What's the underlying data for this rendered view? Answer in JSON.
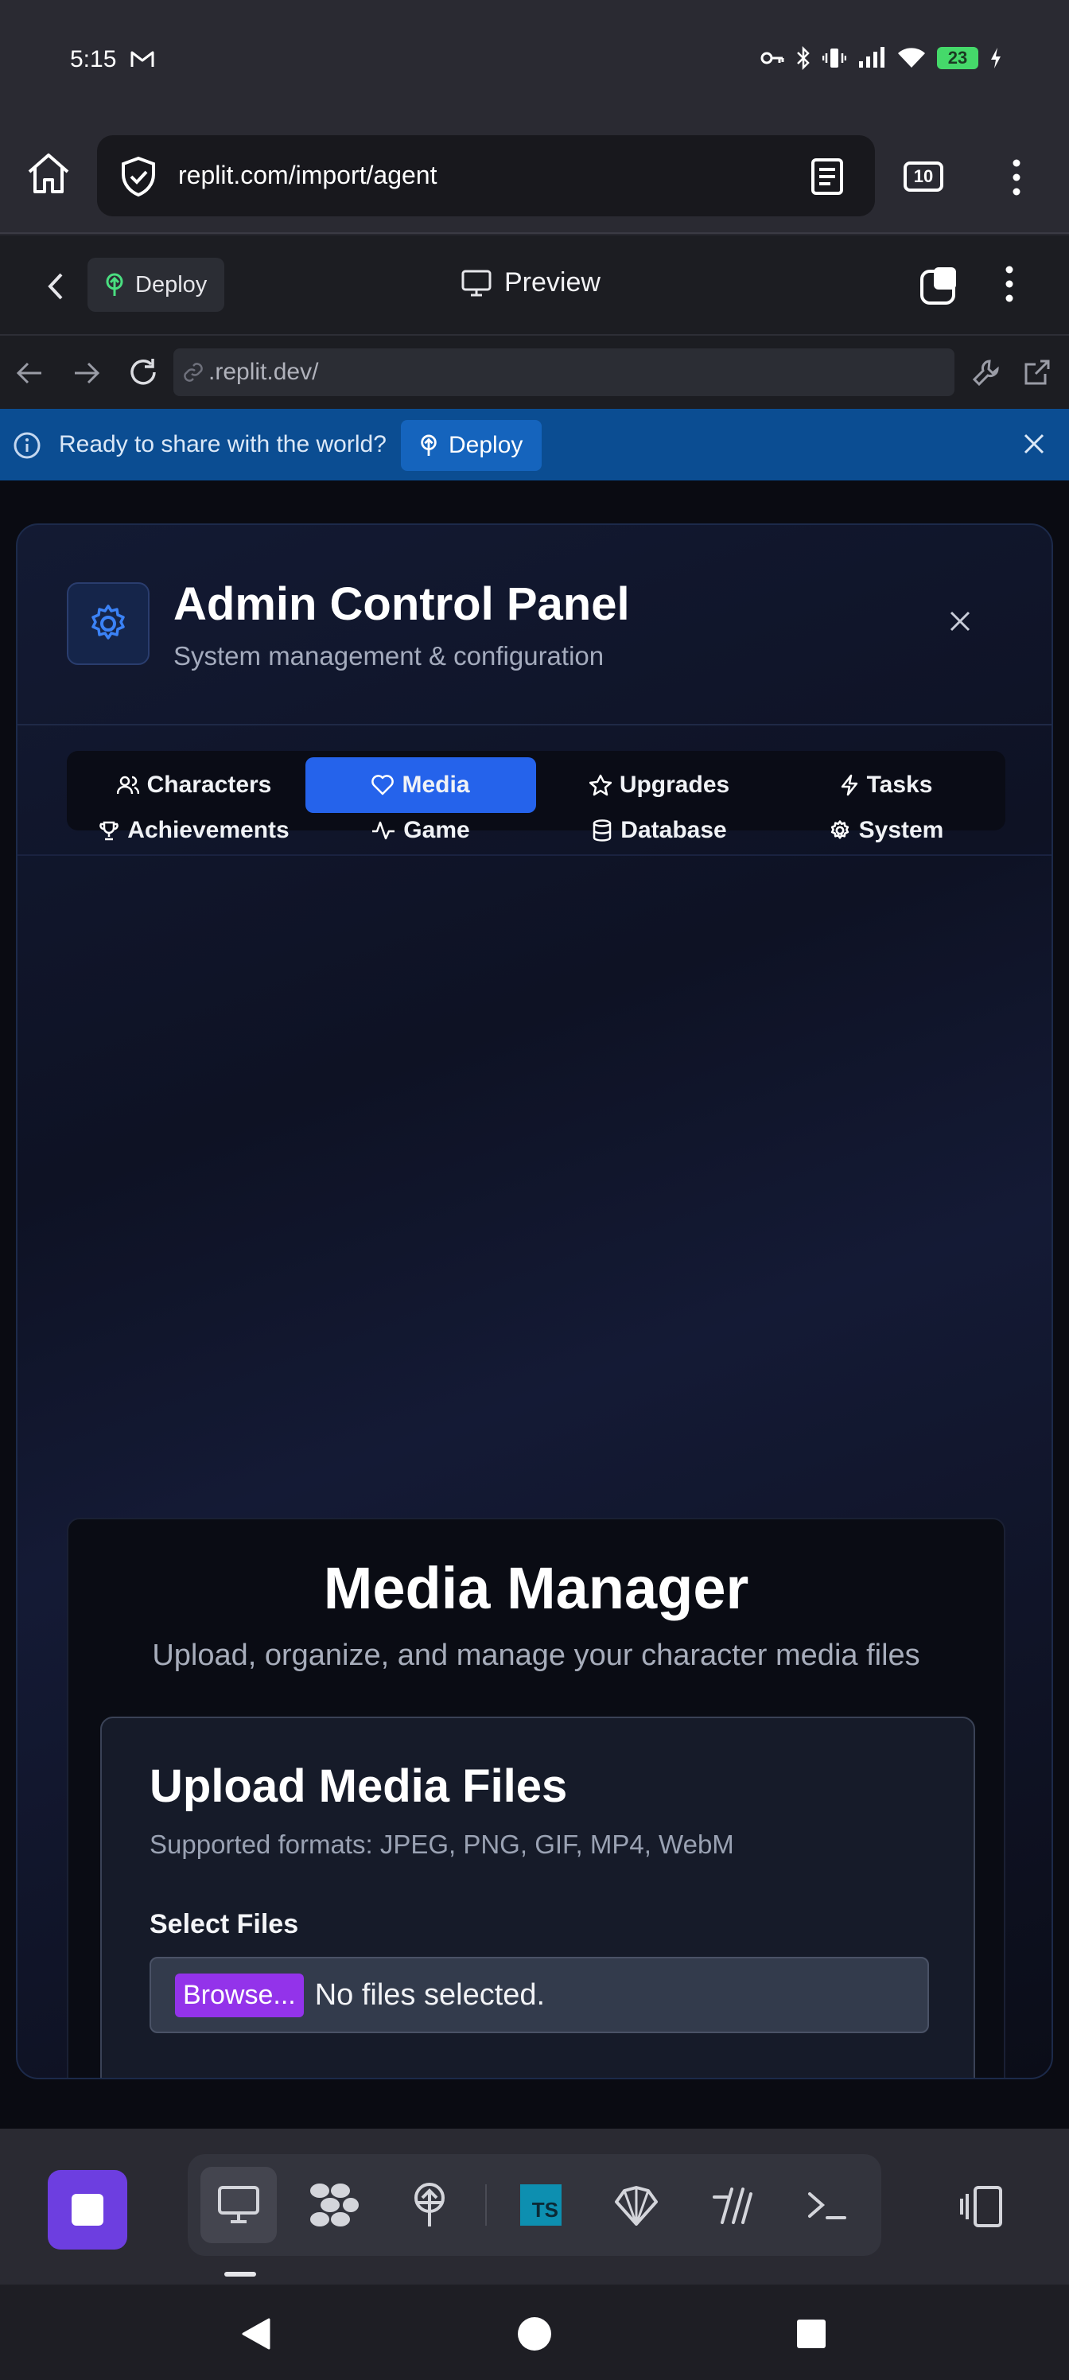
{
  "status_bar": {
    "time": "5:15",
    "battery": "23",
    "icons": [
      "gmail-icon",
      "key-icon",
      "bluetooth-icon",
      "vibrate-icon",
      "signal-icon",
      "wifi-icon",
      "battery-icon"
    ]
  },
  "browser": {
    "url": "replit.com/import/agent",
    "tab_count": "10"
  },
  "replit_header": {
    "deploy_label": "Deploy",
    "preview_label": "Preview"
  },
  "webview_nav": {
    "url": ".replit.dev/"
  },
  "banner": {
    "message": "Ready to share with the world?",
    "deploy_label": "Deploy",
    "color": "#0b4d92"
  },
  "panel": {
    "title": "Admin Control Panel",
    "subtitle": "System management & configuration",
    "tabs": [
      {
        "label": "Characters",
        "icon": "users-icon"
      },
      {
        "label": "Media",
        "icon": "heart-icon",
        "active": true
      },
      {
        "label": "Upgrades",
        "icon": "star-icon"
      },
      {
        "label": "Tasks",
        "icon": "lightning-icon"
      },
      {
        "label": "Achievements",
        "icon": "trophy-icon"
      },
      {
        "label": "Game",
        "icon": "activity-icon"
      },
      {
        "label": "Database",
        "icon": "database-icon"
      },
      {
        "label": "System",
        "icon": "gear-icon"
      }
    ],
    "accent": "#2563eb"
  },
  "media_manager": {
    "title": "Media Manager",
    "subtitle": "Upload, organize, and manage your character media files",
    "upload": {
      "title": "Upload Media Files",
      "formats": "Supported formats: JPEG, PNG, GIF, MP4, WebM",
      "select_label": "Select Files",
      "browse_label": "Browse...",
      "file_status": "No files selected."
    }
  },
  "bottom_toolbar": {
    "tools": [
      "preview-icon",
      "workflows-icon",
      "deploy-icon",
      "typescript-icon",
      "shell-icon",
      "git-icon",
      "console-icon",
      "panel-toggle-icon"
    ],
    "ts_label": "TS"
  }
}
